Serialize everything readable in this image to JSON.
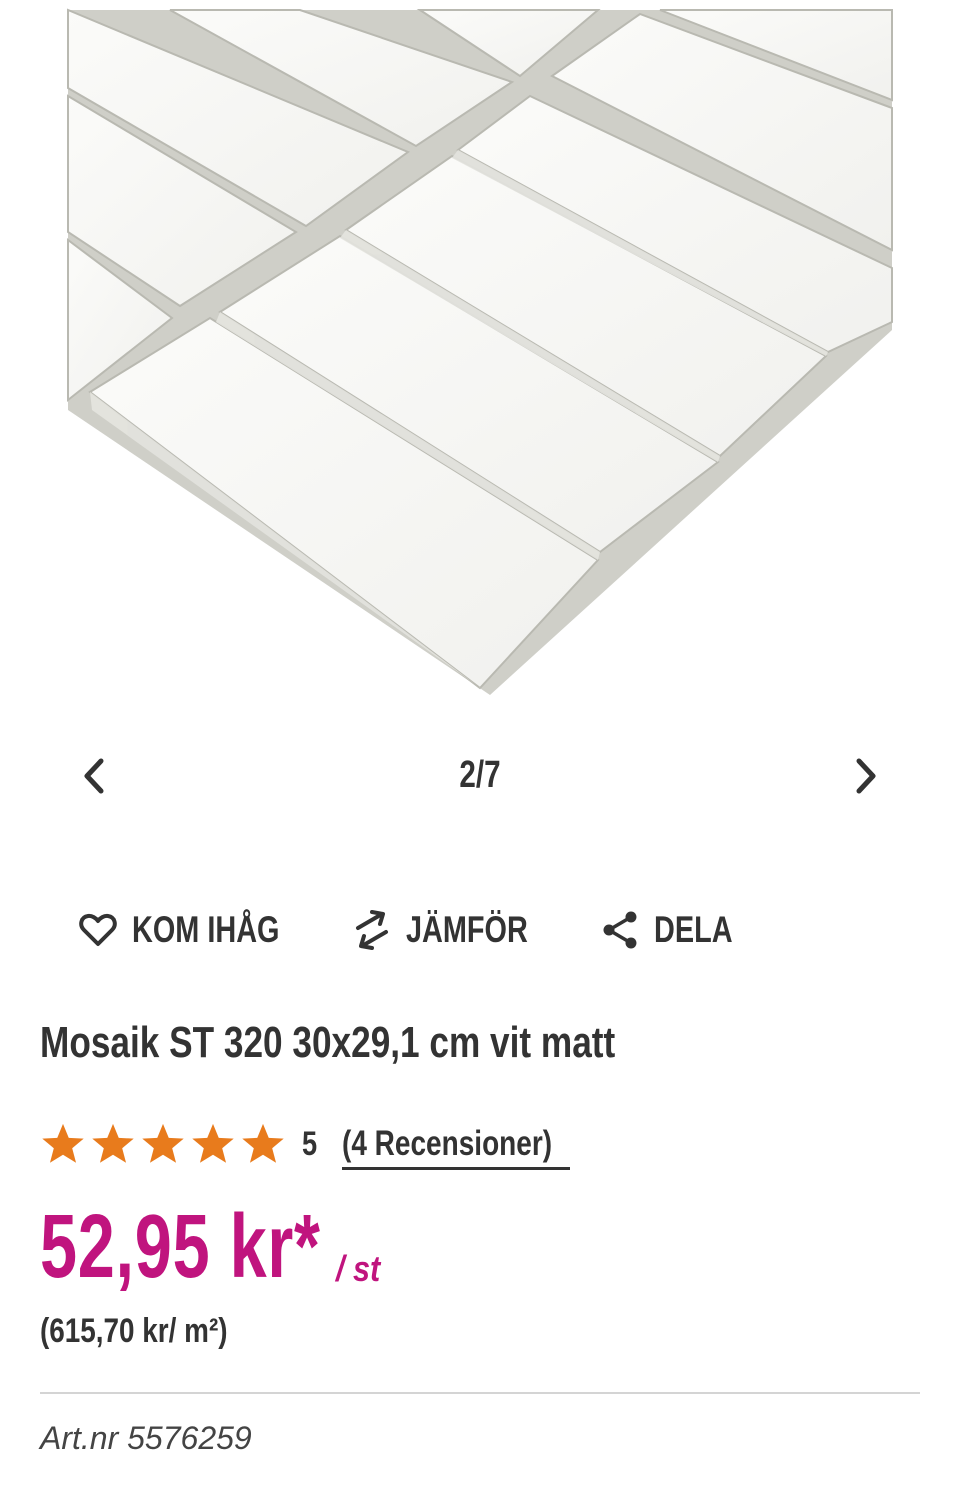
{
  "gallery": {
    "image_name": "product-image-mosaic-tile",
    "counter": "2/7",
    "prev_icon": "chevron-left-icon",
    "next_icon": "chevron-right-icon"
  },
  "actions": {
    "remember": {
      "label": "KOM IHÅG",
      "icon": "heart-icon"
    },
    "compare": {
      "label": "JÄMFÖR",
      "icon": "compare-arrows-icon"
    },
    "share": {
      "label": "DELA",
      "icon": "share-icon"
    }
  },
  "product": {
    "title": "Mosaik ST 320 30x29,1 cm vit matt",
    "rating": {
      "stars": 5,
      "max": 5,
      "score": "5",
      "reviews_label": "(4 Recensioner)"
    },
    "price": {
      "amount": "52,95 kr*",
      "unit": "/ st",
      "per_m2": "(615,70 kr/ m²)"
    },
    "article_number": "Art.nr 5576259"
  },
  "colors": {
    "price": "#c0147e",
    "star": "#e87b1c",
    "text": "#333333"
  }
}
